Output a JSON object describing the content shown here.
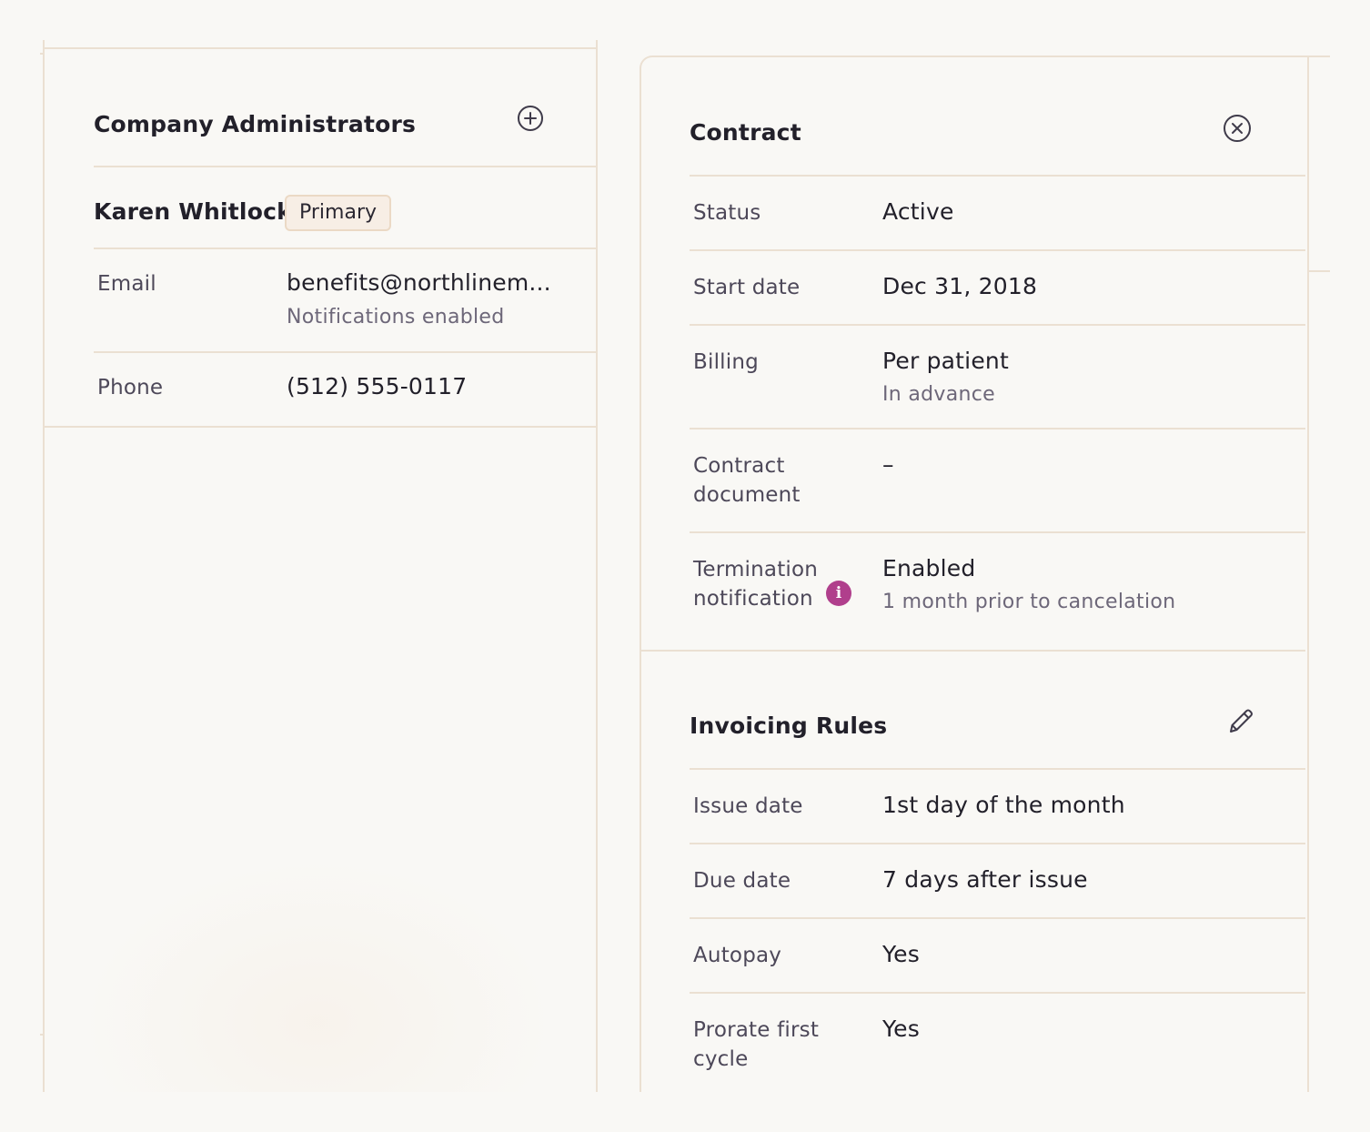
{
  "admins": {
    "title": "Company Administrators",
    "add_icon": "plus-circle-icon",
    "primary": {
      "name": "Karen Whitlock",
      "badge": "Primary",
      "email_label": "Email",
      "email_value": "benefits@northlinem...",
      "email_note": "Notifications enabled",
      "phone_label": "Phone",
      "phone_value": "(512) 555-0117"
    }
  },
  "contract": {
    "title": "Contract",
    "close_icon": "close-circle-icon",
    "rows": [
      {
        "label": "Status",
        "value": "Active",
        "sub": ""
      },
      {
        "label": "Start date",
        "value": "Dec 31, 2018",
        "sub": ""
      },
      {
        "label": "Billing",
        "value": "Per patient",
        "sub": "In advance"
      },
      {
        "label_line1": "Contract",
        "label_line2": "document",
        "value": "–",
        "sub": ""
      },
      {
        "label_line1": "Termination",
        "label_line2": "notification",
        "value": "Enabled",
        "sub": "1 month prior to cancelation",
        "info_icon": "i"
      }
    ]
  },
  "invoicing": {
    "title": "Invoicing Rules",
    "edit_icon": "pencil-icon",
    "rows": [
      {
        "label": "Issue date",
        "value": "1st day of the month"
      },
      {
        "label": "Due date",
        "value": "7 days after issue"
      },
      {
        "label": "Autopay",
        "value": "Yes"
      },
      {
        "label_line1": "Prorate first",
        "label_line2": "cycle",
        "value": "Yes"
      }
    ]
  },
  "colors": {
    "background": "#f9f8f5",
    "border": "#ebe0d2",
    "badge_bg": "#f7eee5",
    "info_accent": "#b03f8c",
    "label_text": "#4d4859",
    "muted_text": "#6d6779"
  }
}
